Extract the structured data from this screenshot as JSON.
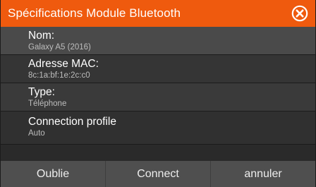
{
  "dialog": {
    "title": "Spécifications Module Bluetooth",
    "close_icon": "close-circle-icon",
    "accent_color": "#ef5a0e"
  },
  "rows": [
    {
      "label": "Nom:",
      "value": "Galaxy A5 (2016)"
    },
    {
      "label": "Adresse MAC:",
      "value": "8c:1a:bf:1e:2c:c0"
    },
    {
      "label": "Type:",
      "value": "Téléphone"
    },
    {
      "label": "Connection profile",
      "value": "Auto"
    }
  ],
  "buttons": {
    "forget": "Oublie",
    "connect": "Connect",
    "cancel": "annuler"
  }
}
